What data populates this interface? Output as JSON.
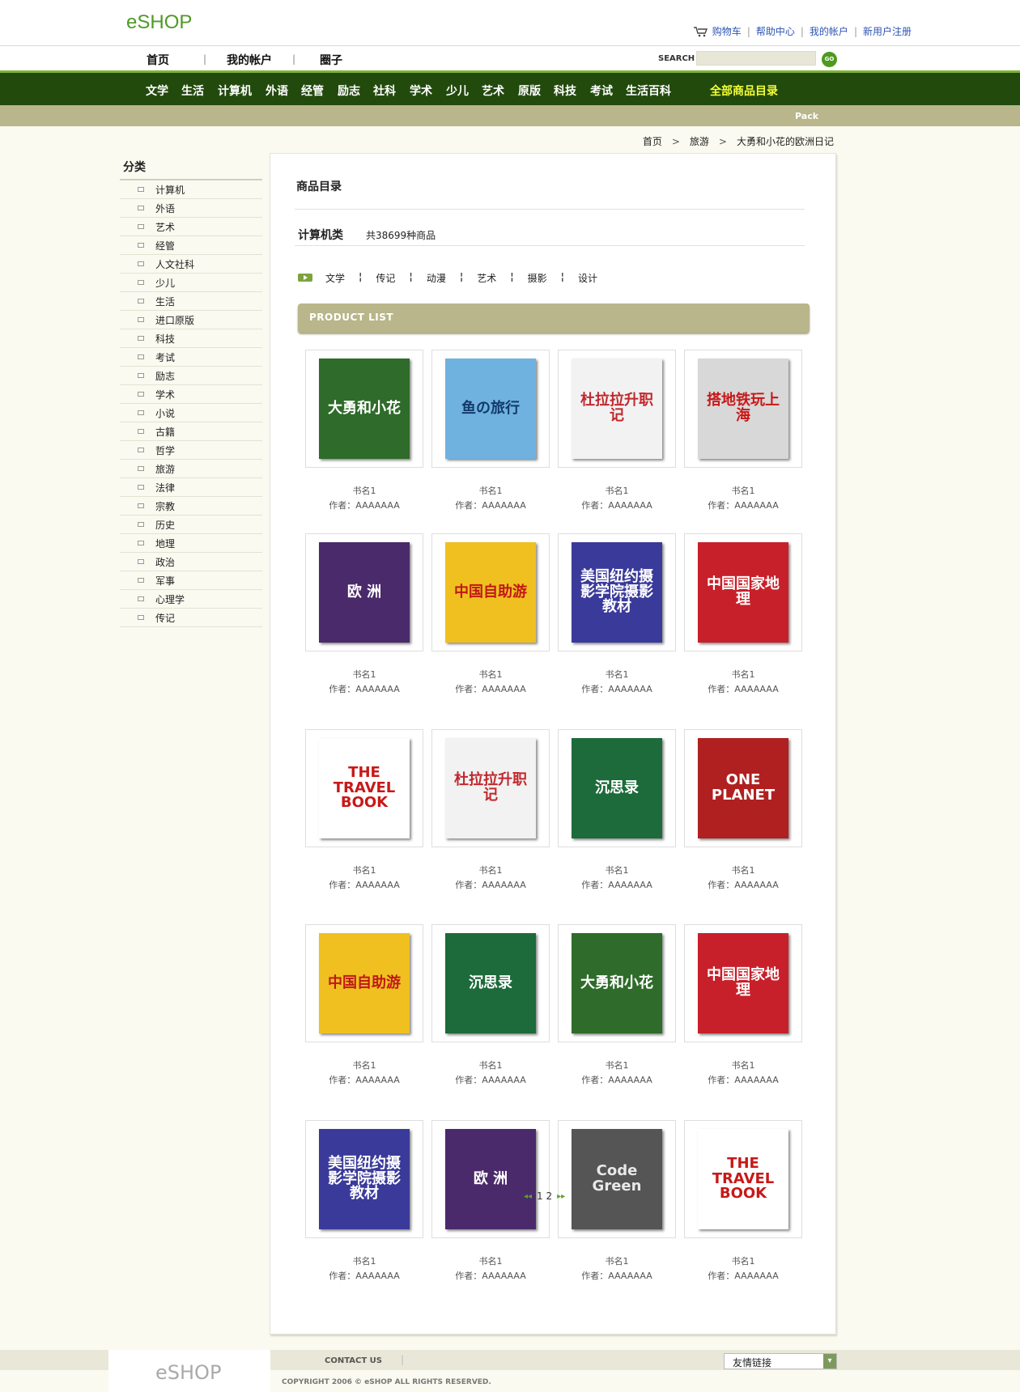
{
  "header": {
    "logo": "eSHOP",
    "links": [
      "购物车",
      "帮助中心",
      "我的帐户",
      "新用户注册"
    ]
  },
  "nav": {
    "items": [
      "首页",
      "我的帐户",
      "圈子"
    ],
    "search_label": "SEARCH",
    "search_placeholder": "",
    "go_label": "GO"
  },
  "categories": [
    "文学",
    "生活",
    "计算机",
    "外语",
    "经管",
    "励志",
    "社科",
    "学术",
    "少儿",
    "艺术",
    "原版",
    "科技",
    "考试",
    "生活百科"
  ],
  "all_categories": "全部商品目录",
  "subbar_label": "Pack",
  "breadcrumb": [
    "首页",
    "旅游",
    "大勇和小花的欧洲日记"
  ],
  "sidebar": {
    "title": "分类",
    "items": [
      "计算机",
      "外语",
      "艺术",
      "经管",
      "人文社科",
      "少儿",
      "生活",
      "进口原版",
      "科技",
      "考试",
      "励志",
      "学术",
      "小说",
      "古籍",
      "哲学",
      "旅游",
      "法律",
      "宗教",
      "历史",
      "地理",
      "政治",
      "军事",
      "心理学",
      "传记"
    ]
  },
  "main": {
    "title": "商品目录",
    "category_name": "计算机类",
    "category_count": "共38699种商品",
    "tags": [
      "文学",
      "传记",
      "动漫",
      "艺术",
      "摄影",
      "设计"
    ],
    "product_list_label": "PRODUCT LIST"
  },
  "products": [
    {
      "name": "书名1",
      "author": "作者：AAAAAAA",
      "cover": {
        "title": "大勇和小花",
        "bg": "#2f6b2a",
        "fg": "#ffffff"
      }
    },
    {
      "name": "书名1",
      "author": "作者：AAAAAAA",
      "cover": {
        "title": "鱼の旅行",
        "bg": "#6fb2e0",
        "fg": "#123a6a"
      }
    },
    {
      "name": "书名1",
      "author": "作者：AAAAAAA",
      "cover": {
        "title": "杜拉拉升职记",
        "bg": "#f2f2f2",
        "fg": "#c0282d"
      }
    },
    {
      "name": "书名1",
      "author": "作者：AAAAAAA",
      "cover": {
        "title": "搭地铁玩上海",
        "bg": "#d8d8d8",
        "fg": "#c81818"
      }
    },
    {
      "name": "书名1",
      "author": "作者：AAAAAAA",
      "cover": {
        "title": "欧 洲",
        "bg": "#4a2a6a",
        "fg": "#ffffff"
      }
    },
    {
      "name": "书名1",
      "author": "作者：AAAAAAA",
      "cover": {
        "title": "中国自助游",
        "bg": "#f0c020",
        "fg": "#c01818"
      }
    },
    {
      "name": "书名1",
      "author": "作者：AAAAAAA",
      "cover": {
        "title": "美国纽约摄影学院摄影教材",
        "bg": "#3a3a9a",
        "fg": "#ffffff"
      }
    },
    {
      "name": "书名1",
      "author": "作者：AAAAAAA",
      "cover": {
        "title": "中国国家地理",
        "bg": "#c8202a",
        "fg": "#ffffff"
      }
    },
    {
      "name": "书名1",
      "author": "作者：AAAAAAA",
      "cover": {
        "title": "THE TRAVEL BOOK",
        "bg": "#ffffff",
        "fg": "#c81818"
      }
    },
    {
      "name": "书名1",
      "author": "作者：AAAAAAA",
      "cover": {
        "title": "杜拉拉升职记",
        "bg": "#f2f2f2",
        "fg": "#c0282d"
      }
    },
    {
      "name": "书名1",
      "author": "作者：AAAAAAA",
      "cover": {
        "title": "沉思录",
        "bg": "#1d6a3a",
        "fg": "#ffffff"
      }
    },
    {
      "name": "书名1",
      "author": "作者：AAAAAAA",
      "cover": {
        "title": "ONE PLANET",
        "bg": "#b02020",
        "fg": "#ffffff"
      }
    },
    {
      "name": "书名1",
      "author": "作者：AAAAAAA",
      "cover": {
        "title": "中国自助游",
        "bg": "#f0c020",
        "fg": "#c01818"
      }
    },
    {
      "name": "书名1",
      "author": "作者：AAAAAAA",
      "cover": {
        "title": "沉思录",
        "bg": "#1d6a3a",
        "fg": "#ffffff"
      }
    },
    {
      "name": "书名1",
      "author": "作者：AAAAAAA",
      "cover": {
        "title": "大勇和小花",
        "bg": "#2f6b2a",
        "fg": "#ffffff"
      }
    },
    {
      "name": "书名1",
      "author": "作者：AAAAAAA",
      "cover": {
        "title": "中国国家地理",
        "bg": "#c8202a",
        "fg": "#ffffff"
      }
    },
    {
      "name": "书名1",
      "author": "作者：AAAAAAA",
      "cover": {
        "title": "美国纽约摄影学院摄影教材",
        "bg": "#3a3a9a",
        "fg": "#ffffff"
      }
    },
    {
      "name": "书名1",
      "author": "作者：AAAAAAA",
      "cover": {
        "title": "欧 洲",
        "bg": "#4a2a6a",
        "fg": "#ffffff"
      }
    },
    {
      "name": "书名1",
      "author": "作者：AAAAAAA",
      "cover": {
        "title": "Code Green",
        "bg": "#555555",
        "fg": "#e8e8e8"
      }
    },
    {
      "name": "书名1",
      "author": "作者：AAAAAAA",
      "cover": {
        "title": "THE TRAVEL BOOK",
        "bg": "#ffffff",
        "fg": "#c81818"
      }
    }
  ],
  "pager": {
    "prev": "◂◂",
    "pages": "1 2",
    "next": "▸▸"
  },
  "footer": {
    "logo": "eSHOP",
    "contact": "CONTACT US",
    "links_select": "友情链接",
    "copyright": "COPYRIGHT 2006 © eSHOP ALL RIGHTS RESERVED."
  },
  "colors": {
    "accent": "#4f9a24",
    "dark_green": "#224a0d",
    "khaki": "#b8b68a",
    "link_blue": "#2d54b4"
  }
}
